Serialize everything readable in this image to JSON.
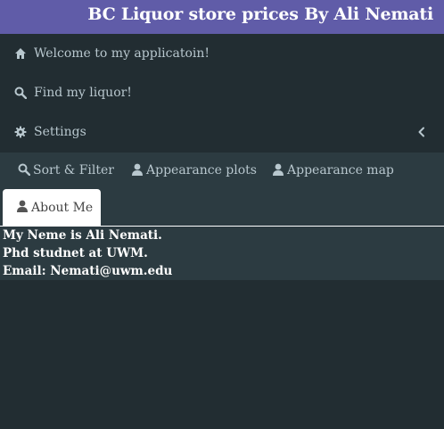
{
  "header": {
    "title": "BC Liquor store prices By Ali Nemati",
    "color": "#605ca8"
  },
  "sidebar": {
    "items": [
      {
        "label": "Welcome to my applicatoin!",
        "icon": "home-icon"
      },
      {
        "label": "Find my liquor!",
        "icon": "search-icon"
      },
      {
        "label": "Settings",
        "icon": "gear-icon",
        "trailing_icon": "chevron-left-icon"
      }
    ]
  },
  "tabs": {
    "items": [
      {
        "label": "Sort & Filter",
        "icon": "search-icon"
      },
      {
        "label": "Appearance plots",
        "icon": "user-icon"
      },
      {
        "label": "Appearance map",
        "icon": "user-icon"
      },
      {
        "label": "About Me",
        "icon": "user-icon",
        "active": true
      }
    ]
  },
  "about": {
    "lines": [
      "My Neme is Ali Nemati.",
      "Phd studnet at UWM.",
      "Email: Nemati@uwm.edu"
    ]
  },
  "colors": {
    "sidebar_bg": "#222d32",
    "panel_bg": "#2c3b41",
    "muted_text": "#b8c7ce",
    "active_tab_bg": "#ffffff"
  }
}
